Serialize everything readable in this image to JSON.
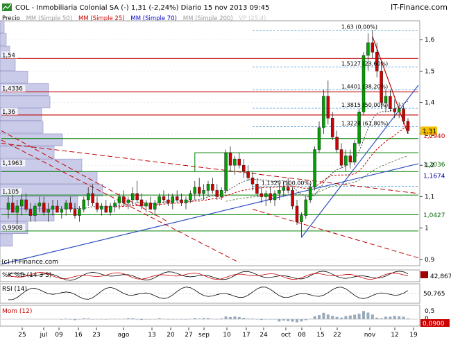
{
  "header": {
    "title": "COL - Inmobiliaria Colonial SA (-)   1,31 (-2,24%)   Diario  15 nov 2013 09:45",
    "brand": "IT-Finance.com",
    "watermark": "(c) IT-Finance.com"
  },
  "legend": [
    {
      "label": "Precio",
      "color": "#000000"
    },
    {
      "label": "MM (Simple 50)",
      "color": "#9a9a9a"
    },
    {
      "label": "MM (Simple 25)",
      "color": "#cc0000"
    },
    {
      "label": "MM (Simple 70)",
      "color": "#0000cc"
    },
    {
      "label": "MM (Simple 200)",
      "color": "#9a9a9a"
    },
    {
      "label": "VP (25,4)",
      "color": "#cccccc"
    }
  ],
  "colors": {
    "up": "#00a000",
    "down": "#d00000",
    "resistance": "#c00000",
    "support": "#008000",
    "fib": "#5fa3d8",
    "trend": "#3050c0",
    "volume_profile": "#c9cbe8",
    "grid": "#dddddd"
  },
  "chart_data": [
    {
      "type": "candlestick",
      "title": "COL - Inmobiliaria Colonial SA (-)",
      "ylim": [
        0.88,
        1.66
      ],
      "y_ticks": [
        "1,6",
        "1,5",
        "1,4",
        "1,3",
        "1,2",
        "1,1",
        "1",
        "0,9"
      ],
      "x_ticks": [
        "25",
        "jul",
        "09",
        "16",
        "23",
        "ago",
        "13",
        "20",
        "27",
        "sep",
        "10",
        "17",
        "24",
        "oct",
        "08",
        "15",
        "22",
        "nov",
        "12",
        "19"
      ],
      "last_price": {
        "label": "1,31",
        "value": 1.31
      },
      "price_labels": [
        {
          "label": "1,2940",
          "value": 1.294
        },
        {
          "label": "1,2036",
          "value": 1.2036
        },
        {
          "label": "1,1674",
          "value": 1.1674
        },
        {
          "label": "1,0427",
          "value": 1.0427
        }
      ],
      "left_levels": [
        {
          "label": "1,54",
          "value": 1.54
        },
        {
          "label": "1,4336",
          "value": 1.4336
        },
        {
          "label": "1,36",
          "value": 1.36
        },
        {
          "label": "1,1963",
          "value": 1.1963
        },
        {
          "label": "1,105",
          "value": 1.105
        },
        {
          "label": "0,9908",
          "value": 0.9908
        }
      ],
      "fibonacci": [
        {
          "label": "1,63 (0,00%)",
          "value": 1.63
        },
        {
          "label": "1,5127 (23,60%)",
          "value": 1.5127
        },
        {
          "label": "1,4401 (38,20%)",
          "value": 1.4401
        },
        {
          "label": "1,3815 (50,00%)",
          "value": 1.3815
        },
        {
          "label": "1,3228 (61,80%)",
          "value": 1.3228
        },
        {
          "label": "1,1329 (100,00%)",
          "value": 1.1329
        }
      ],
      "resistance_lines": [
        1.54,
        1.4336,
        1.36
      ],
      "support_lines": [
        1.285,
        1.18,
        1.105,
        1.0427,
        0.9908
      ],
      "candles": [
        {
          "o": 1.06,
          "h": 1.1,
          "l": 1.03,
          "c": 1.08
        },
        {
          "o": 1.08,
          "h": 1.12,
          "l": 1.05,
          "c": 1.05
        },
        {
          "o": 1.05,
          "h": 1.09,
          "l": 1.01,
          "c": 1.07
        },
        {
          "o": 1.07,
          "h": 1.11,
          "l": 1.04,
          "c": 1.09
        },
        {
          "o": 1.09,
          "h": 1.11,
          "l": 1.05,
          "c": 1.06
        },
        {
          "o": 1.06,
          "h": 1.08,
          "l": 1.02,
          "c": 1.04
        },
        {
          "o": 1.04,
          "h": 1.08,
          "l": 1.02,
          "c": 1.07
        },
        {
          "o": 1.07,
          "h": 1.1,
          "l": 1.05,
          "c": 1.08
        },
        {
          "o": 1.08,
          "h": 1.1,
          "l": 1.04,
          "c": 1.05
        },
        {
          "o": 1.05,
          "h": 1.08,
          "l": 1.02,
          "c": 1.06
        },
        {
          "o": 1.06,
          "h": 1.09,
          "l": 1.04,
          "c": 1.07
        },
        {
          "o": 1.07,
          "h": 1.09,
          "l": 1.05,
          "c": 1.05
        },
        {
          "o": 1.05,
          "h": 1.07,
          "l": 1.03,
          "c": 1.06
        },
        {
          "o": 1.06,
          "h": 1.09,
          "l": 1.04,
          "c": 1.08
        },
        {
          "o": 1.08,
          "h": 1.1,
          "l": 1.05,
          "c": 1.06
        },
        {
          "o": 1.06,
          "h": 1.08,
          "l": 1.03,
          "c": 1.04
        },
        {
          "o": 1.04,
          "h": 1.07,
          "l": 1.02,
          "c": 1.06
        },
        {
          "o": 1.06,
          "h": 1.1,
          "l": 1.05,
          "c": 1.09
        },
        {
          "o": 1.09,
          "h": 1.13,
          "l": 1.07,
          "c": 1.11
        },
        {
          "o": 1.11,
          "h": 1.14,
          "l": 1.07,
          "c": 1.08
        },
        {
          "o": 1.08,
          "h": 1.1,
          "l": 1.05,
          "c": 1.06
        },
        {
          "o": 1.06,
          "h": 1.08,
          "l": 1.04,
          "c": 1.07
        },
        {
          "o": 1.07,
          "h": 1.09,
          "l": 1.05,
          "c": 1.05
        },
        {
          "o": 1.05,
          "h": 1.08,
          "l": 1.04,
          "c": 1.07
        },
        {
          "o": 1.07,
          "h": 1.09,
          "l": 1.05,
          "c": 1.08
        },
        {
          "o": 1.08,
          "h": 1.11,
          "l": 1.06,
          "c": 1.1
        },
        {
          "o": 1.1,
          "h": 1.12,
          "l": 1.07,
          "c": 1.08
        },
        {
          "o": 1.08,
          "h": 1.1,
          "l": 1.06,
          "c": 1.09
        },
        {
          "o": 1.09,
          "h": 1.13,
          "l": 1.07,
          "c": 1.11
        },
        {
          "o": 1.11,
          "h": 1.15,
          "l": 1.08,
          "c": 1.09
        },
        {
          "o": 1.09,
          "h": 1.11,
          "l": 1.06,
          "c": 1.07
        },
        {
          "o": 1.07,
          "h": 1.09,
          "l": 1.05,
          "c": 1.08
        },
        {
          "o": 1.08,
          "h": 1.1,
          "l": 1.06,
          "c": 1.06
        },
        {
          "o": 1.06,
          "h": 1.09,
          "l": 1.04,
          "c": 1.08
        },
        {
          "o": 1.08,
          "h": 1.11,
          "l": 1.07,
          "c": 1.1
        },
        {
          "o": 1.1,
          "h": 1.12,
          "l": 1.08,
          "c": 1.09
        },
        {
          "o": 1.09,
          "h": 1.11,
          "l": 1.07,
          "c": 1.08
        },
        {
          "o": 1.08,
          "h": 1.11,
          "l": 1.06,
          "c": 1.1
        },
        {
          "o": 1.1,
          "h": 1.12,
          "l": 1.08,
          "c": 1.09
        },
        {
          "o": 1.09,
          "h": 1.11,
          "l": 1.07,
          "c": 1.08
        },
        {
          "o": 1.08,
          "h": 1.1,
          "l": 1.06,
          "c": 1.09
        },
        {
          "o": 1.09,
          "h": 1.12,
          "l": 1.08,
          "c": 1.11
        },
        {
          "o": 1.11,
          "h": 1.15,
          "l": 1.09,
          "c": 1.13
        },
        {
          "o": 1.13,
          "h": 1.16,
          "l": 1.1,
          "c": 1.11
        },
        {
          "o": 1.11,
          "h": 1.14,
          "l": 1.09,
          "c": 1.12
        },
        {
          "o": 1.12,
          "h": 1.15,
          "l": 1.1,
          "c": 1.14
        },
        {
          "o": 1.14,
          "h": 1.16,
          "l": 1.11,
          "c": 1.12
        },
        {
          "o": 1.12,
          "h": 1.14,
          "l": 1.09,
          "c": 1.1
        },
        {
          "o": 1.1,
          "h": 1.13,
          "l": 1.09,
          "c": 1.12
        },
        {
          "o": 1.12,
          "h": 1.25,
          "l": 1.11,
          "c": 1.24
        },
        {
          "o": 1.24,
          "h": 1.26,
          "l": 1.18,
          "c": 1.2
        },
        {
          "o": 1.2,
          "h": 1.23,
          "l": 1.17,
          "c": 1.22
        },
        {
          "o": 1.22,
          "h": 1.24,
          "l": 1.19,
          "c": 1.2
        },
        {
          "o": 1.2,
          "h": 1.22,
          "l": 1.16,
          "c": 1.18
        },
        {
          "o": 1.18,
          "h": 1.2,
          "l": 1.15,
          "c": 1.16
        },
        {
          "o": 1.16,
          "h": 1.18,
          "l": 1.12,
          "c": 1.14
        },
        {
          "o": 1.14,
          "h": 1.16,
          "l": 1.1,
          "c": 1.11
        },
        {
          "o": 1.11,
          "h": 1.13,
          "l": 1.08,
          "c": 1.1
        },
        {
          "o": 1.1,
          "h": 1.12,
          "l": 1.07,
          "c": 1.11
        },
        {
          "o": 1.11,
          "h": 1.13,
          "l": 1.08,
          "c": 1.09
        },
        {
          "o": 1.09,
          "h": 1.12,
          "l": 1.07,
          "c": 1.11
        },
        {
          "o": 1.11,
          "h": 1.14,
          "l": 1.09,
          "c": 1.12
        },
        {
          "o": 1.12,
          "h": 1.15,
          "l": 1.1,
          "c": 1.13
        },
        {
          "o": 1.13,
          "h": 1.16,
          "l": 1.11,
          "c": 1.12
        },
        {
          "o": 1.12,
          "h": 1.13,
          "l": 1.06,
          "c": 1.07
        },
        {
          "o": 1.07,
          "h": 1.09,
          "l": 1.01,
          "c": 1.02
        },
        {
          "o": 1.02,
          "h": 1.05,
          "l": 0.97,
          "c": 1.04
        },
        {
          "o": 1.04,
          "h": 1.1,
          "l": 1.03,
          "c": 1.09
        },
        {
          "o": 1.09,
          "h": 1.14,
          "l": 1.08,
          "c": 1.13
        },
        {
          "o": 1.13,
          "h": 1.26,
          "l": 1.12,
          "c": 1.25
        },
        {
          "o": 1.25,
          "h": 1.34,
          "l": 1.24,
          "c": 1.32
        },
        {
          "o": 1.32,
          "h": 1.44,
          "l": 1.3,
          "c": 1.42
        },
        {
          "o": 1.42,
          "h": 1.47,
          "l": 1.33,
          "c": 1.35
        },
        {
          "o": 1.35,
          "h": 1.37,
          "l": 1.28,
          "c": 1.29
        },
        {
          "o": 1.29,
          "h": 1.31,
          "l": 1.24,
          "c": 1.25
        },
        {
          "o": 1.25,
          "h": 1.27,
          "l": 1.19,
          "c": 1.2
        },
        {
          "o": 1.2,
          "h": 1.25,
          "l": 1.18,
          "c": 1.23
        },
        {
          "o": 1.23,
          "h": 1.25,
          "l": 1.19,
          "c": 1.21
        },
        {
          "o": 1.21,
          "h": 1.28,
          "l": 1.2,
          "c": 1.27
        },
        {
          "o": 1.27,
          "h": 1.38,
          "l": 1.26,
          "c": 1.37
        },
        {
          "o": 1.37,
          "h": 1.56,
          "l": 1.36,
          "c": 1.55
        },
        {
          "o": 1.55,
          "h": 1.62,
          "l": 1.5,
          "c": 1.59
        },
        {
          "o": 1.59,
          "h": 1.63,
          "l": 1.54,
          "c": 1.56
        },
        {
          "o": 1.56,
          "h": 1.59,
          "l": 1.48,
          "c": 1.5
        },
        {
          "o": 1.5,
          "h": 1.53,
          "l": 1.38,
          "c": 1.4
        },
        {
          "o": 1.4,
          "h": 1.44,
          "l": 1.37,
          "c": 1.42
        },
        {
          "o": 1.42,
          "h": 1.44,
          "l": 1.37,
          "c": 1.38
        },
        {
          "o": 1.38,
          "h": 1.41,
          "l": 1.35,
          "c": 1.37
        },
        {
          "o": 1.37,
          "h": 1.4,
          "l": 1.35,
          "c": 1.38
        },
        {
          "o": 1.38,
          "h": 1.39,
          "l": 1.33,
          "c": 1.34
        },
        {
          "o": 1.34,
          "h": 1.35,
          "l": 1.3,
          "c": 1.31
        }
      ]
    },
    {
      "type": "line",
      "title": "%K %D (14 3 3)",
      "ylim": [
        -10,
        110
      ],
      "value_labels": [
        {
          "label": "42,867",
          "value": 42.867
        }
      ]
    },
    {
      "type": "line",
      "title": "RSI (14)",
      "ylim": [
        20,
        80
      ],
      "value_labels": [
        {
          "label": "50,765",
          "value": 50.765
        }
      ]
    },
    {
      "type": "bar",
      "title": "Mom (12)",
      "ylim": [
        -0.5,
        0.5
      ],
      "y_ticks": [
        "0,5",
        "0"
      ],
      "value_labels": [
        {
          "label": "0,0900",
          "value": 0.09
        }
      ]
    }
  ]
}
